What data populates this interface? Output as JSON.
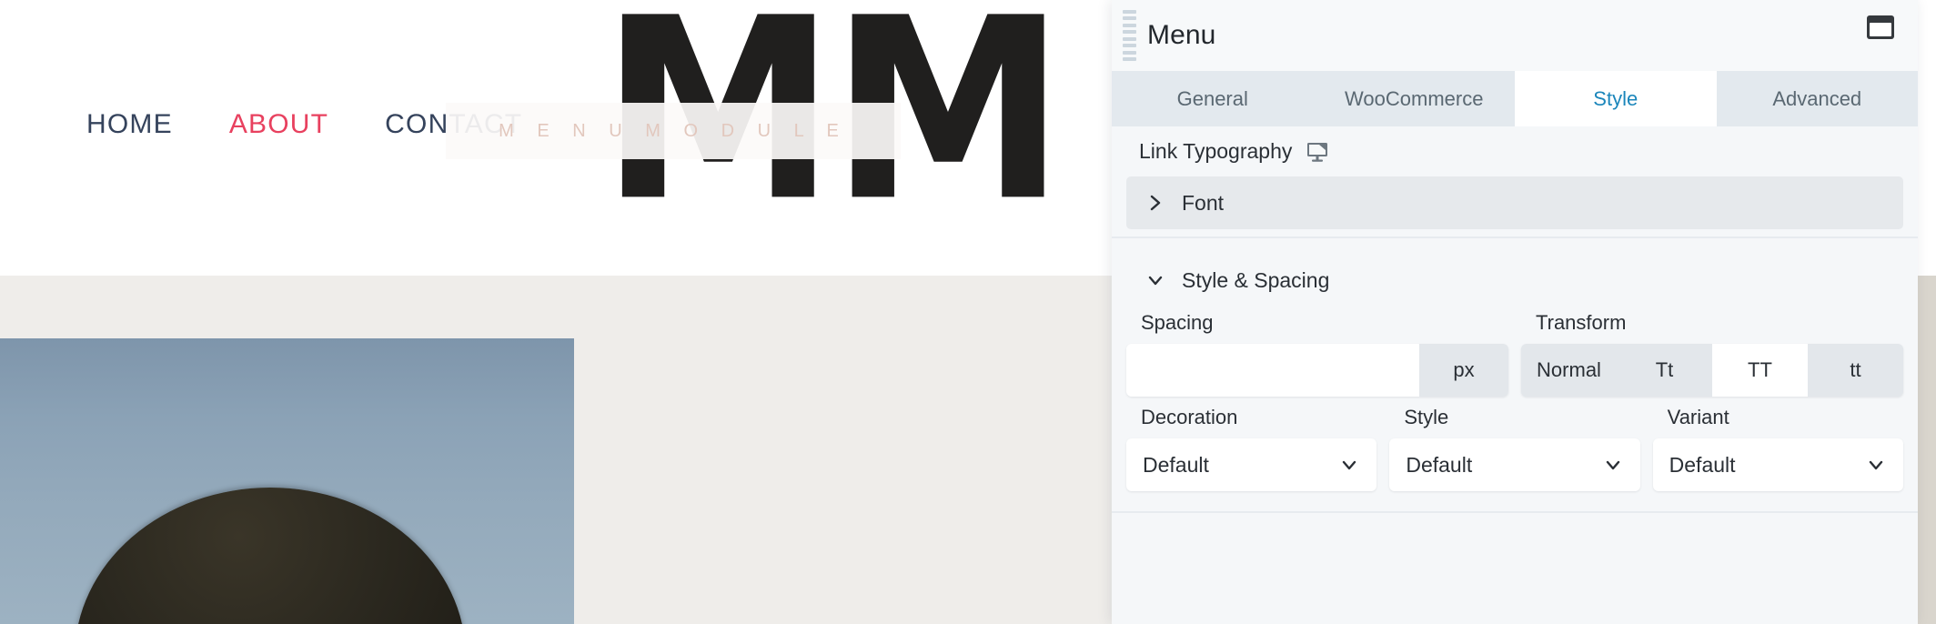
{
  "site": {
    "nav": [
      {
        "label": "HOME",
        "active": false
      },
      {
        "label": "ABOUT",
        "active": true
      },
      {
        "label": "CONTACT",
        "active": false
      }
    ],
    "logo": {
      "monogram": "MM",
      "tagline": "M E N U   M O D U L E"
    },
    "colors": {
      "nav_default": "#35435c",
      "nav_active": "#e8415f",
      "tagline": "#e2c7bd",
      "band": "#efedea"
    }
  },
  "panel": {
    "title": "Menu",
    "drag_handle_icon": "drag-handle-icon",
    "layout_icon": "panel-layout-icon",
    "tabs": [
      {
        "label": "General",
        "active": false
      },
      {
        "label": "WooCommerce",
        "active": false
      },
      {
        "label": "Style",
        "active": true
      },
      {
        "label": "Advanced",
        "active": false
      }
    ],
    "active_tab_color": "#1b86bb",
    "field": {
      "label": "Link Typography",
      "responsive_icon": "monitor-icon"
    },
    "accordions": [
      {
        "label": "Font",
        "expanded": false,
        "icon": "chevron-right-icon"
      },
      {
        "label": "Style & Spacing",
        "expanded": true,
        "icon": "chevron-down-icon"
      }
    ],
    "controls": {
      "spacing": {
        "label": "Spacing",
        "value": "",
        "placeholder": "",
        "unit": "px"
      },
      "transform": {
        "label": "Transform",
        "options": [
          {
            "label": "Normal",
            "active": false
          },
          {
            "label": "Tt",
            "active": false
          },
          {
            "label": "TT",
            "active": true
          },
          {
            "label": "tt",
            "active": false
          }
        ]
      },
      "decoration": {
        "label": "Decoration",
        "value": "Default"
      },
      "style": {
        "label": "Style",
        "value": "Default"
      },
      "variant": {
        "label": "Variant",
        "value": "Default"
      }
    }
  }
}
